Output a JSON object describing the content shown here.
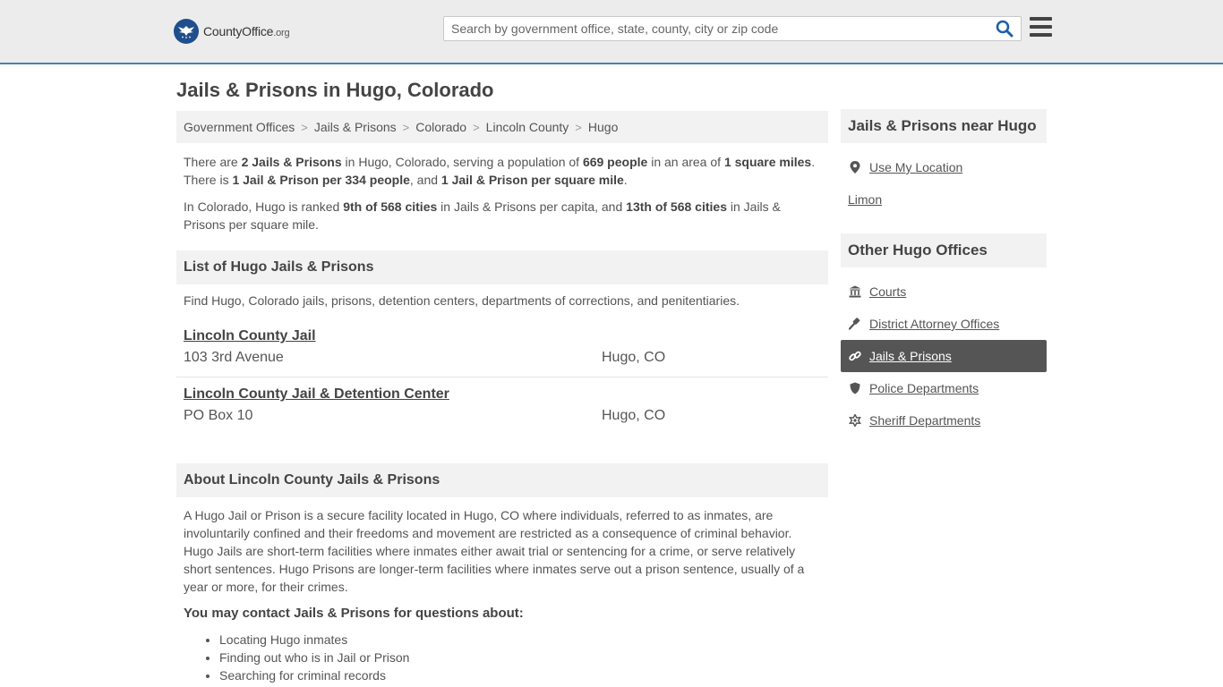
{
  "header": {
    "logo_brand": "CountyOffice",
    "logo_tld": ".org",
    "search_placeholder": "Search by government office, state, county, city or zip code"
  },
  "page_title": "Jails & Prisons in Hugo, Colorado",
  "breadcrumb": [
    "Government Offices",
    "Jails & Prisons",
    "Colorado",
    "Lincoln County",
    "Hugo"
  ],
  "intro": {
    "p1_a": "There are ",
    "p1_b": "2 Jails & Prisons",
    "p1_c": " in Hugo, Colorado, serving a population of ",
    "p1_d": "669 people",
    "p1_e": " in an area of ",
    "p1_f": "1 square miles",
    "p1_g": ". There is ",
    "p1_h": "1 Jail & Prison per 334 people",
    "p1_i": ", and ",
    "p1_j": "1 Jail & Prison per square mile",
    "p1_k": ".",
    "p2_a": "In Colorado, Hugo is ranked ",
    "p2_b": "9th of 568 cities",
    "p2_c": " in Jails & Prisons per capita, and ",
    "p2_d": "13th of 568 cities",
    "p2_e": " in Jails & Prisons per square mile."
  },
  "list_section": {
    "heading": "List of Hugo Jails & Prisons",
    "description": "Find Hugo, Colorado jails, prisons, detention centers, departments of corrections, and penitentiaries.",
    "items": [
      {
        "name": "Lincoln County Jail",
        "address": "103 3rd Avenue",
        "city": "Hugo, CO"
      },
      {
        "name": "Lincoln County Jail & Detention Center",
        "address": "PO Box 10",
        "city": "Hugo, CO"
      }
    ]
  },
  "about_section": {
    "heading": "About Lincoln County Jails & Prisons",
    "text": "A Hugo Jail or Prison is a secure facility located in Hugo, CO where individuals, referred to as inmates, are involuntarily confined and their freedoms and movement are restricted as a consequence of criminal behavior. Hugo Jails are short-term facilities where inmates either await trial or sentencing for a crime, or serve relatively short sentences. Hugo Prisons are longer-term facilities where inmates serve out a prison sentence, usually of a year or more, for their crimes.",
    "contact_heading": "You may contact Jails & Prisons for questions about:",
    "contact_items": [
      "Locating Hugo inmates",
      "Finding out who is in Jail or Prison",
      "Searching for criminal records"
    ]
  },
  "sidebar": {
    "nearby_heading": "Jails & Prisons near Hugo",
    "use_location": "Use My Location",
    "nearby_city": "Limon",
    "other_heading": "Other Hugo Offices",
    "offices": [
      {
        "label": "Courts",
        "icon": "courthouse-icon"
      },
      {
        "label": "District Attorney Offices",
        "icon": "gavel-icon"
      },
      {
        "label": "Jails & Prisons",
        "icon": "link-icon"
      },
      {
        "label": "Police Departments",
        "icon": "shield-icon"
      },
      {
        "label": "Sheriff Departments",
        "icon": "star-badge-icon"
      }
    ]
  },
  "colors": {
    "brand_blue": "#1f4e8c",
    "header_border": "#4d7fb5",
    "active_bg": "#555555"
  }
}
